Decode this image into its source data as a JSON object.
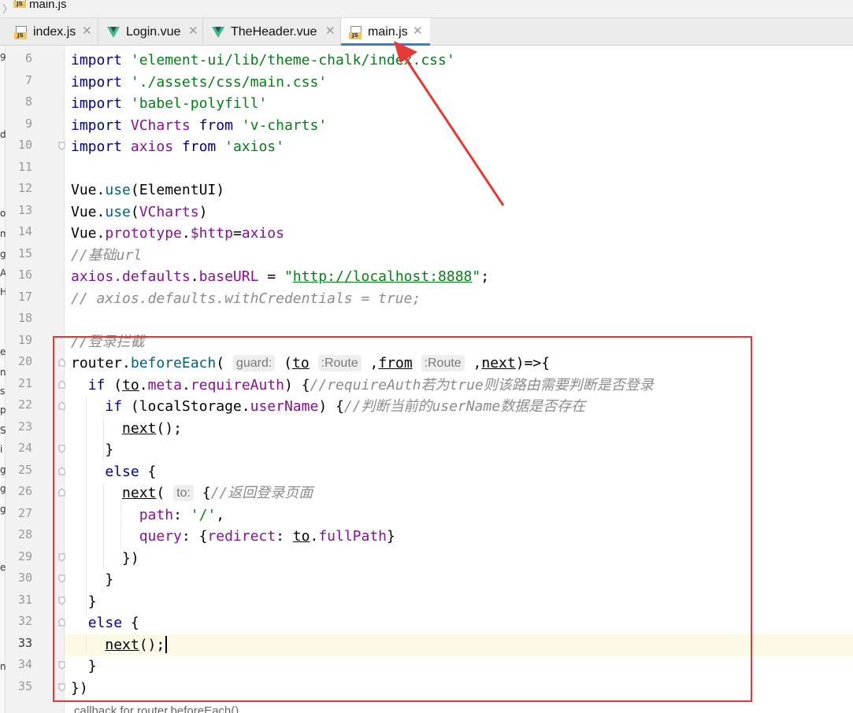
{
  "breadcrumb": {
    "file": "main.js"
  },
  "tabs": [
    {
      "label": "index.js",
      "icon": "js-file-icon",
      "active": false
    },
    {
      "label": "Login.vue",
      "icon": "vue-file-icon",
      "active": false
    },
    {
      "label": "TheHeader.vue",
      "icon": "vue-file-icon",
      "active": false
    },
    {
      "label": "main.js",
      "icon": "js-file-icon",
      "active": true
    }
  ],
  "colors": {
    "annotation_red": "#e53935",
    "active_tab_underline": "#3a7bd5",
    "current_line": "#fcfae6"
  },
  "line_numbers": [
    "6",
    "7",
    "8",
    "9",
    "10",
    "11",
    "12",
    "13",
    "14",
    "15",
    "16",
    "17",
    "18",
    "19",
    "20",
    "21",
    "22",
    "23",
    "24",
    "25",
    "26",
    "27",
    "28",
    "29",
    "30",
    "31",
    "32",
    "33",
    "34",
    "35"
  ],
  "current_line": "33",
  "code": {
    "l6": {
      "kw": "import",
      "str": "'element-ui/lib/theme-chalk/index.css'"
    },
    "l7": {
      "kw": "import",
      "str": "'./assets/css/main.css'"
    },
    "l8": {
      "kw": "import",
      "str": "'babel-polyfill'"
    },
    "l9": {
      "kw": "import",
      "ident": "VCharts",
      "from": "from",
      "str": "'v-charts'"
    },
    "l10": {
      "kw": "import",
      "ident": "axios",
      "from": "from",
      "str": "'axios'"
    },
    "l12": {
      "obj": "Vue.",
      "fn": "use",
      "arg": "(ElementUI)"
    },
    "l13": {
      "obj": "Vue.",
      "fn": "use",
      "arg": "(",
      "argp": "VCharts",
      "close": ")"
    },
    "l14": {
      "obj": "Vue.",
      "prop": "prototype",
      "dot": ".",
      "prop2": "$http",
      "eq": "=",
      "val": "axios"
    },
    "l15": {
      "comment": "//基础url"
    },
    "l16": {
      "obj": "axios.",
      "prop": "defaults",
      "dot": ".",
      "prop2": "baseURL",
      "eq": " = ",
      "q1": "\"",
      "url": "http://localhost:8888",
      "q2": "\"",
      "end": ";"
    },
    "l17": {
      "comment": "// axios.defaults.withCredentials = true;"
    },
    "l19": {
      "comment": "//登录拦截"
    },
    "l20": {
      "obj": "router.",
      "fn": "beforeEach",
      "p1": "(",
      "hint1": "guard:",
      "p2": "(",
      "to": "to",
      "hint2": ":Route",
      "comma1": ",",
      "from": "from",
      "hint3": ":Route",
      "comma2": ",",
      "next": "next",
      "tail": ")=>{"
    },
    "l21": {
      "kw": "if",
      "open": " (",
      "to": "to",
      "dot": ".",
      "meta": "meta",
      "dot2": ".",
      "req": "requireAuth",
      "close": ") {",
      "comment": "//requireAuth若为true则该路由需要判断是否登录"
    },
    "l22": {
      "kw": "if",
      "open": " (localStorage.",
      "prop": "userName",
      "close": ") {",
      "comment": "//判断当前的userName数据是否存在"
    },
    "l23": {
      "next": "next",
      "tail": "();"
    },
    "l24": {
      "text": "}"
    },
    "l25": {
      "kw": "else",
      "tail": " {"
    },
    "l26": {
      "next": "next",
      "p": "(",
      "hint": "to:",
      "tail": "{",
      "comment": "//返回登录页面"
    },
    "l27": {
      "key": "path",
      "colon": ": ",
      "str": "'/'",
      "tail": ","
    },
    "l28": {
      "key": "query",
      "colon": ": {",
      "key2": "redirect",
      "colon2": ": ",
      "to": "to",
      "dot": ".",
      "prop": "fullPath",
      "tail": "}"
    },
    "l29": {
      "text": "})"
    },
    "l30": {
      "text": "}"
    },
    "l31": {
      "text": "}"
    },
    "l32": {
      "kw": "else",
      "tail": " {"
    },
    "l33": {
      "next": "next",
      "tail": "();"
    },
    "l34": {
      "text": "}"
    },
    "l35": {
      "text": "})"
    }
  },
  "status": {
    "text": "callback for router.beforeEach()"
  },
  "left_strip_chars": [
    "9",
    "d",
    "o",
    "m",
    "g",
    "A",
    "H",
    "e",
    "n",
    "s",
    "p",
    "S",
    "i",
    "g",
    "g",
    "g",
    "e",
    "n"
  ]
}
